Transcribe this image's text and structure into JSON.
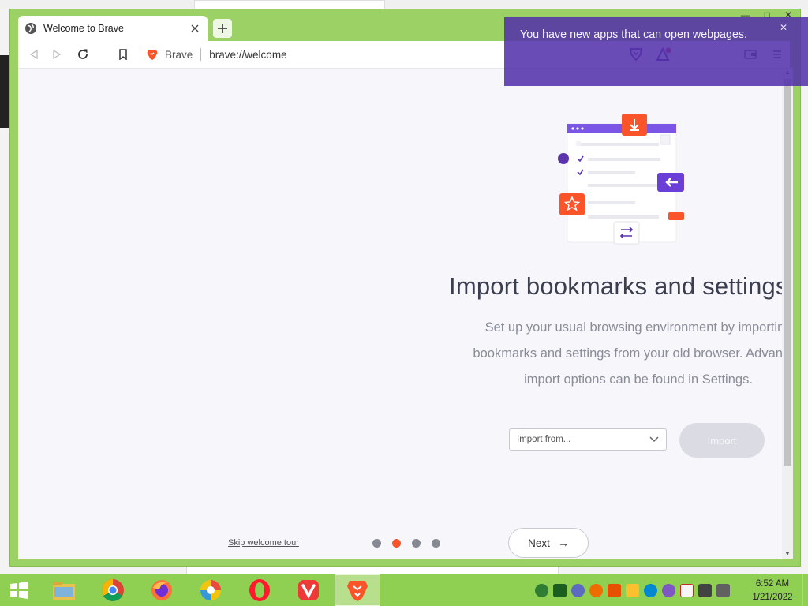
{
  "browser": {
    "tab": {
      "title": "Welcome to Brave",
      "favicon": "globe-icon"
    },
    "window_controls": [
      "minimize",
      "maximize",
      "close"
    ],
    "omnibox": {
      "site_label": "Brave",
      "url": "brave://welcome"
    },
    "toolbar_icons": [
      "back-icon",
      "forward-icon",
      "reload-icon",
      "bookmark-icon",
      "brave-shields-icon",
      "brave-rewards-icon",
      "wallet-icon",
      "menu-icon"
    ]
  },
  "notification": {
    "text": "You have new apps that can open webpages."
  },
  "welcome": {
    "heading": "Import bookmarks and settings",
    "description_lines": [
      "Set up your usual browsing environment by importing",
      "bookmarks and settings from your old browser. Advanced",
      "import options can be found in Settings."
    ],
    "import_select": {
      "selected": "Import from..."
    },
    "import_button": "Import",
    "skip_link": "Skip welcome tour",
    "steps": {
      "total": 4,
      "current": 2
    },
    "next_button": "Next",
    "next_arrow": "→"
  },
  "taskbar": {
    "apps": [
      "file-explorer",
      "chrome",
      "firefox",
      "edge-dev",
      "opera",
      "vivaldi",
      "brave"
    ],
    "active_app": "brave",
    "clock": {
      "time": "6:52 AM",
      "date": "1/21/2022"
    }
  },
  "colors": {
    "window_frame": "#9bd165",
    "accent": "#fb542b",
    "notification": "#5b33ac",
    "heading": "#3b3e4f",
    "taskbar": "#8fd053"
  }
}
